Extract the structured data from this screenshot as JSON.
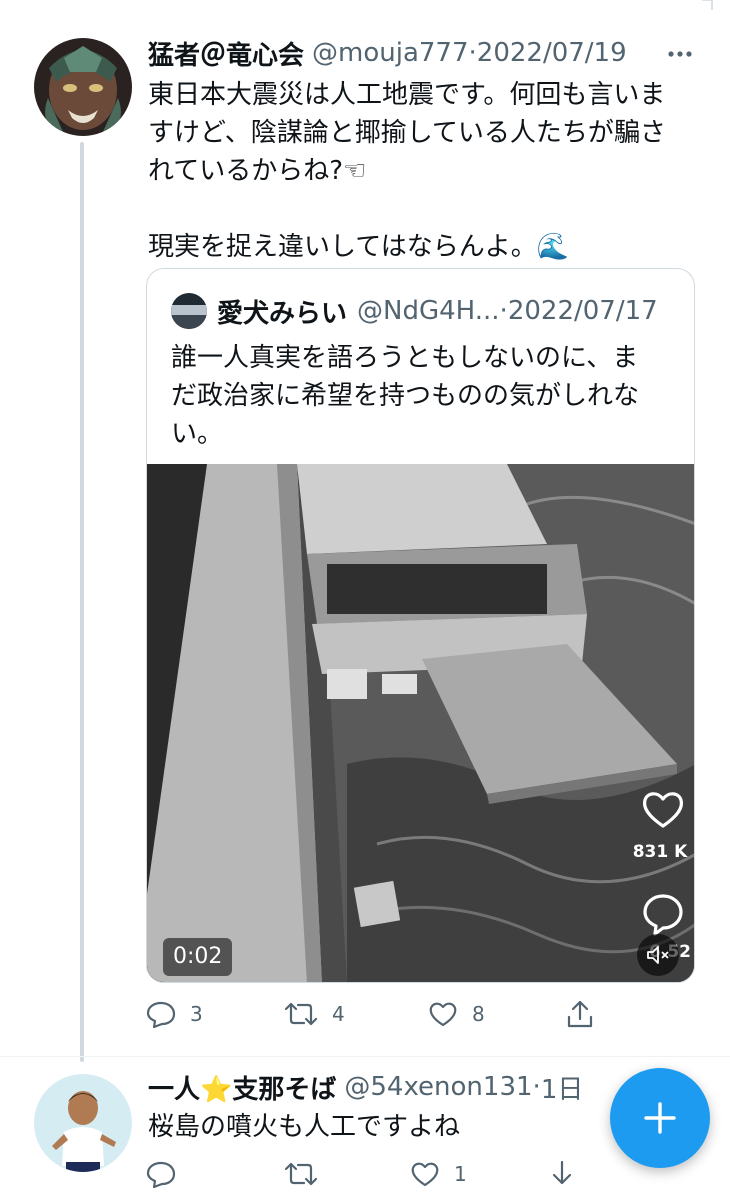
{
  "tweet": {
    "display_name": "猛者＠竜心会",
    "handle": "@mouja777",
    "separator": "·",
    "date": "2022/07/19",
    "more_icon": "more-horizontal-icon",
    "text": "東日本大震災は人工地震です。何回も言いま\nすけど、陰謀論と揶揄している人たちが騙さ\nれているからね?☜\n\n現実を捉え違いしてはならんよ。🌊",
    "quote": {
      "display_name": "愛犬みらい",
      "handle": "@NdG4H...",
      "separator": "·",
      "date": "2022/07/17",
      "text": "誰一人真実を語ろうともしないのに、ま\nだ政治家に希望を持つものの気がしれな\nい。",
      "video": {
        "timestamp": "0:02",
        "likes": "831 K",
        "comments": "6.52",
        "heart_icon": "heart-outline-icon",
        "comment_icon": "comment-bubble-icon",
        "mute_icon": "speaker-muted-icon"
      }
    },
    "actions": {
      "reply_count": "3",
      "retweet_count": "4",
      "like_count": "8",
      "share_icon": "share-icon"
    }
  },
  "reply": {
    "display_name": "一人⭐支那そば",
    "handle": "@54xenon131",
    "separator": "·",
    "date": "1日",
    "text": "桜島の噴火も人工ですよね",
    "actions": {
      "reply_count": "",
      "retweet_count": "",
      "like_count": "1"
    }
  },
  "fab": {
    "icon": "plus-icon",
    "color": "#1d9bf0"
  },
  "colors": {
    "text": "#0f1419",
    "secondary": "#536471",
    "border": "#cfd9de",
    "accent": "#1d9bf0"
  }
}
